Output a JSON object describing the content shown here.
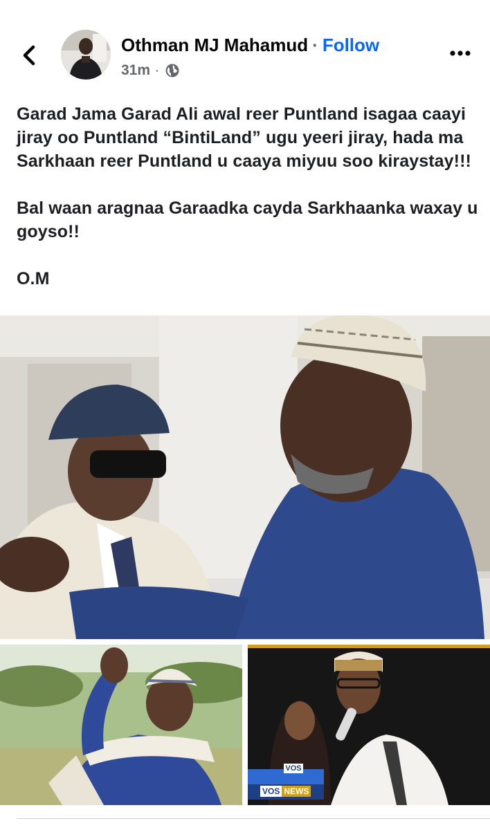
{
  "header": {
    "author_name": "Othman MJ Mahamud",
    "separator": "·",
    "follow_label": "Follow",
    "timestamp": "31m",
    "meta_separator": "·",
    "back_icon": "chevron-left-icon",
    "privacy_icon": "globe-icon",
    "more_icon": "more-horizontal-icon"
  },
  "post": {
    "paragraph_1": "Garad Jama Garad Ali awal reer Puntland isagaa caayi jiray oo Puntland “BintiLand” ugu yeeri jiray, hada ma Sarkhaan reer Puntland u caaya miyuu soo kiraystay!!!",
    "paragraph_2": "Bal waan aragnaa Garaadka cayda Sarkhaanka waxay u goyso!!",
    "paragraph_3": "O.M"
  },
  "photos": {
    "news_logo_top": "VOS",
    "news_logo_bottom": "VOS",
    "news_logo_word": "NEWS"
  },
  "colors": {
    "accent": "#0866ff",
    "text": "#050505",
    "secondary_text": "#65676b",
    "divider": "#ced0d4"
  }
}
